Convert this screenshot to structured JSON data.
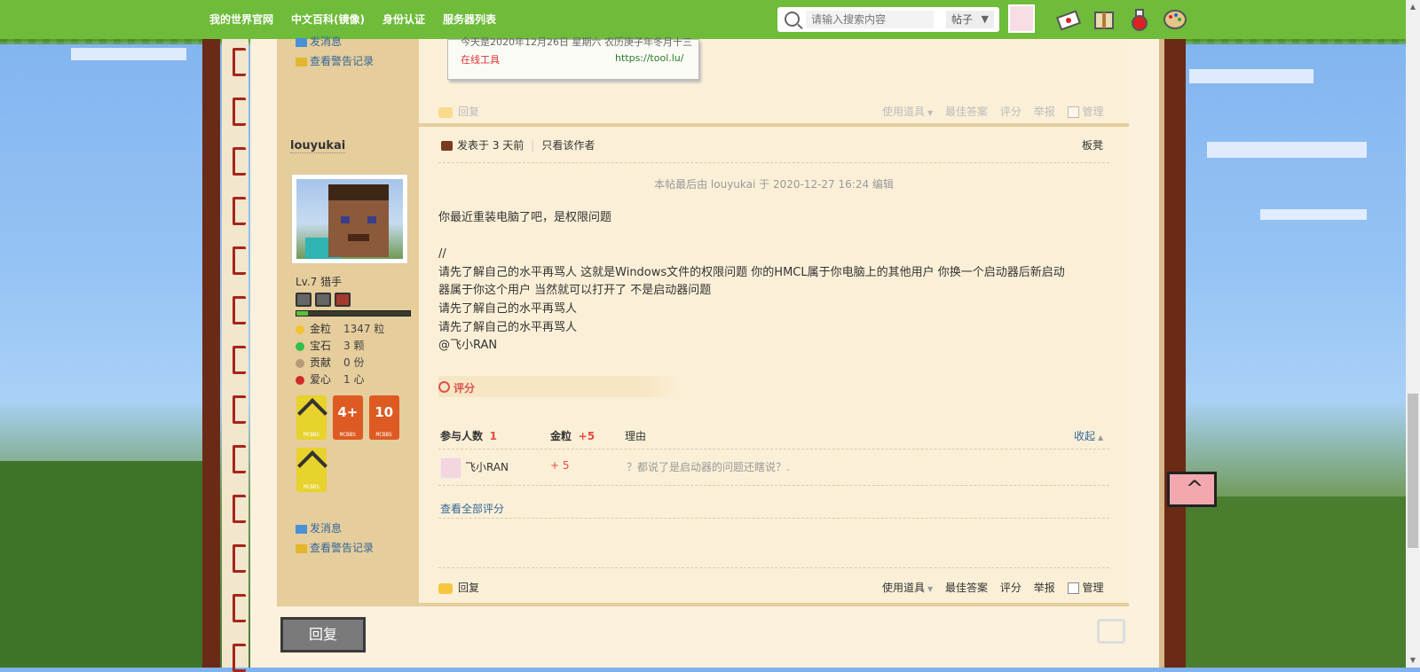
{
  "nav": {
    "links": [
      "我的世界官网",
      "中文百科(镜像)",
      "身份认证",
      "服务器列表"
    ],
    "search_placeholder": "请输入搜索内容",
    "search_type": "帖子"
  },
  "prev_post": {
    "sidebar_link_message": "发消息",
    "sidebar_link_warnings": "查看警告记录",
    "code_line1": "今天是2020年12月26日 星期六 农历庚子年冬月十三",
    "code_tool": "在线工具",
    "code_url": "https://tool.lu/",
    "reply": "回复",
    "actions": [
      "使用道具",
      "最佳答案",
      "评分",
      "举报",
      "管理"
    ]
  },
  "post": {
    "username": "louyukai",
    "level": "Lv.7 猎手",
    "xp_fraction": 0.1,
    "stats": [
      {
        "icon": "gold-nugget-icon",
        "key": "金粒",
        "value": "1347 粒",
        "color": "#f2c230"
      },
      {
        "icon": "emerald-icon",
        "key": "宝石",
        "value": "3 颗",
        "color": "#2fbf4a"
      },
      {
        "icon": "contribution-icon",
        "key": "贡献",
        "value": "0 份",
        "color": "#b59a7a"
      },
      {
        "icon": "heart-apple-icon",
        "key": "爱心",
        "value": "1 心",
        "color": "#d22a2a"
      }
    ],
    "badges": [
      {
        "label": "MCBBS",
        "kind": "pickaxe"
      },
      {
        "label": "MCBBS",
        "kind": "number",
        "num": "4+"
      },
      {
        "label": "MCBBS",
        "kind": "number",
        "num": "10"
      },
      {
        "label": "MCBBS",
        "kind": "pickaxe"
      }
    ],
    "link_message": "发消息",
    "link_warnings": "查看警告记录",
    "posted": "发表于 3 天前",
    "author_only": "只看该作者",
    "floor": "板凳",
    "edited": "本帖最后由 louyukai 于 2020-12-27 16:24 编辑",
    "body_lines": [
      "你最近重装电脑了吧，是权限问题",
      "",
      "//",
      "请先了解自己的水平再骂人 这就是Windows文件的权限问题 你的HMCL属于你电脑上的其他用户 你换一个启动器后新启动",
      "器属于你这个用户 当然就可以打开了 不是启动器问题",
      "请先了解自己的水平再骂人",
      "请先了解自己的水平再骂人",
      "@飞小RAN"
    ],
    "rating": {
      "tab_label": "评分",
      "participants_label": "参与人数",
      "participants": "1",
      "gold_label": "金粒",
      "gold_total": "+5",
      "reason_label": "理由",
      "collapse": "收起",
      "rater": "飞小RAN",
      "rater_gold": "+ 5",
      "rater_reason": "？都说了是启动器的问题还瞎说？.",
      "view_all": "查看全部评分"
    },
    "reply": "回复",
    "actions": [
      "使用道具",
      "最佳答案",
      "评分",
      "举报",
      "管理"
    ]
  },
  "footer": {
    "reply_button": "回复"
  }
}
